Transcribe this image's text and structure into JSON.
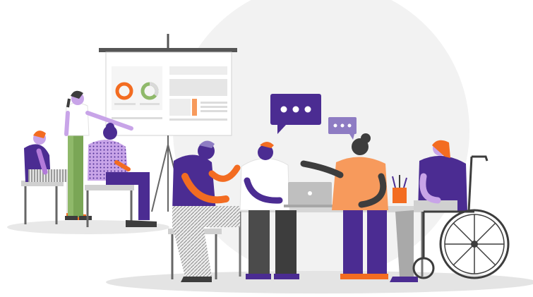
{
  "scene": {
    "subject": "team-meeting-illustration",
    "palette": {
      "purple": "#4b2c92",
      "purple_light": "#8e7cc3",
      "orange": "#f36c21",
      "orange_light": "#f79a5c",
      "green": "#8fb96a",
      "gray_dark": "#3d3d3d",
      "gray_mid": "#9b9b9b",
      "gray_light": "#d9d9d9",
      "skin_light": "#c8a4e8",
      "white": "#ffffff"
    },
    "icons": [
      "chat-bubble-icon",
      "chat-bubble-icon",
      "laptop-icon",
      "wheelchair-icon",
      "pencil-cup-icon",
      "donut-chart-icon"
    ]
  }
}
